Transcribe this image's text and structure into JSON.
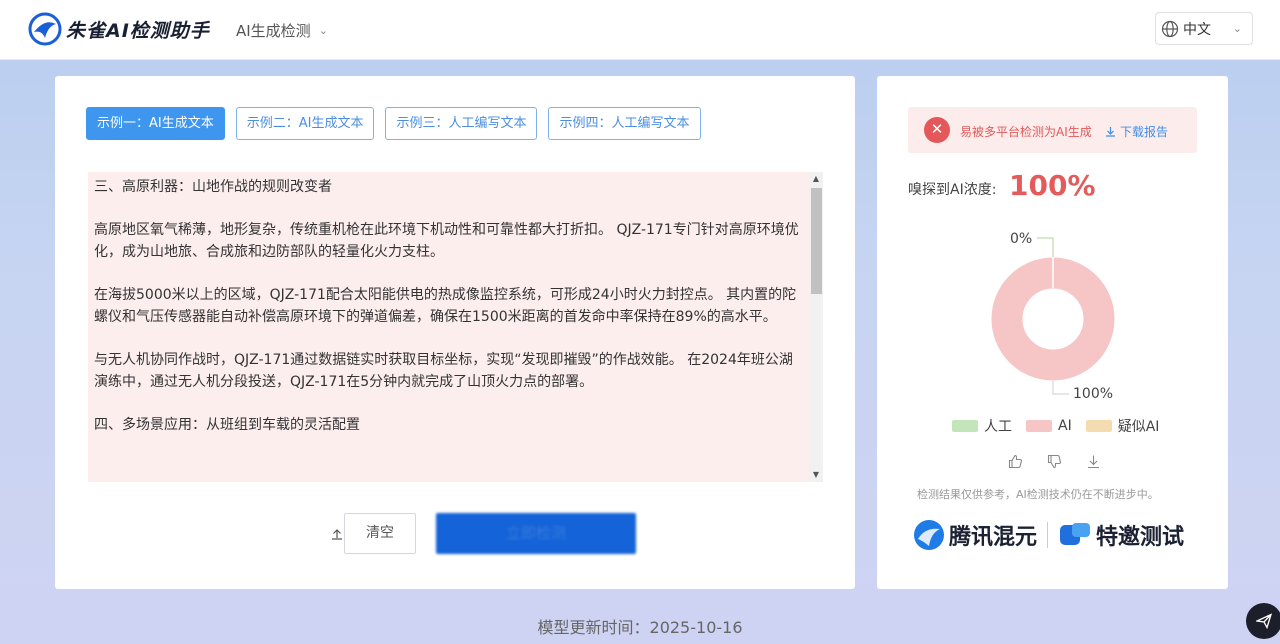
{
  "header": {
    "brand": "朱雀AI检测助手",
    "mode": "AI生成检测",
    "language": "中文"
  },
  "tabs": [
    {
      "label": "示例一：AI生成文本",
      "active": true
    },
    {
      "label": "示例二：AI生成文本",
      "active": false
    },
    {
      "label": "示例三：人工编写文本",
      "active": false
    },
    {
      "label": "示例四：人工编写文本",
      "active": false
    }
  ],
  "text": {
    "paragraphs": [
      "三、高原利器：山地作战的规则改变者",
      "高原地区氧气稀薄，地形复杂，传统重机枪在此环境下机动性和可靠性都大打折扣。 QJZ-171专门针对高原环境优化，成为山地旅、合成旅和边防部队的轻量化火力支柱。",
      "在海拔5000米以上的区域，QJZ-171配合太阳能供电的热成像监控系统，可形成24小时火力封控点。 其内置的陀螺仪和气压传感器能自动补偿高原环境下的弹道偏差，确保在1500米距离的首发命中率保持在89%的高水平。",
      "与无人机协同作战时，QJZ-171通过数据链实时获取目标坐标，实现“发现即摧毁”的作战效能。 在2024年班公湖演练中，通过无人机分段投送，QJZ-171在5分钟内就完成了山顶火力点的部署。",
      "四、多场景应用：从班组到车载的灵活配置"
    ]
  },
  "actions": {
    "upload": "上传",
    "clear": "清空",
    "detect": "立即检测"
  },
  "result": {
    "alert": "易被多平台检测为AI生成",
    "download": "下载报告",
    "concentration_label": "嗅探到AI浓度:",
    "concentration_value": "100%",
    "donut_label_zero": "0%",
    "donut_label_full": "100%",
    "legend": [
      {
        "label": "人工",
        "color": "#c3e5b9"
      },
      {
        "label": "AI",
        "color": "#f6c5c5"
      },
      {
        "label": "疑似AI",
        "color": "#f5dcb0"
      }
    ],
    "note": "检测结果仅供参考，AI检测技术仍在不断进步中。",
    "partner_a": "腾讯混元",
    "partner_b": "特邀测试",
    "ai_fraction": 1.0
  },
  "footer": {
    "label": "模型更新时间：",
    "date": "2025-10-16"
  },
  "colors": {
    "accent": "#3f96ee",
    "detect_button": "#1463d8",
    "alert_red": "#e4585a",
    "donut_ai": "#f6c5c5"
  }
}
